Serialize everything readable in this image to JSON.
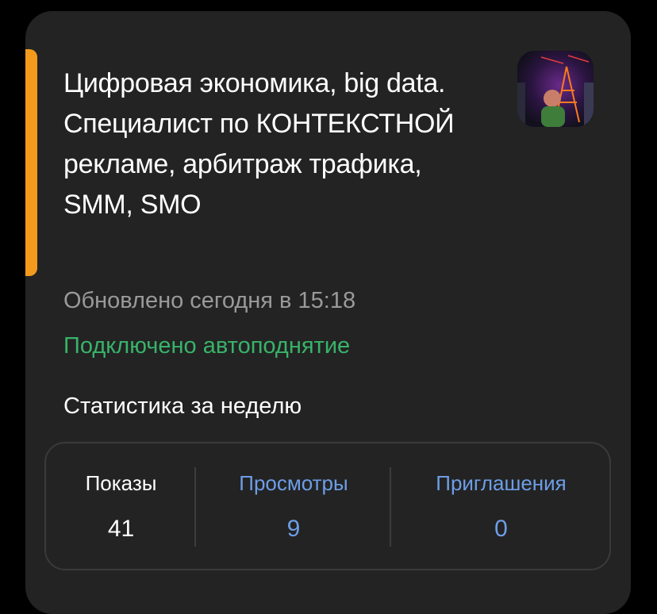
{
  "card": {
    "title": "Цифровая экономика, big data. Специалист по КОНТЕКСТНОЙ рекламе, арбитраж трафика, SMM, SMO",
    "updated": "Обновлено сегодня в 15:18",
    "autoraise": "Подключено автоподнятие",
    "stats_heading": "Статистика за неделю",
    "accent_color": "#f39a1d",
    "status_color": "#38b36a",
    "link_color": "#6d9ee6"
  },
  "stats": {
    "shows": {
      "label": "Показы",
      "value": "41"
    },
    "views": {
      "label": "Просмотры",
      "value": "9"
    },
    "invites": {
      "label": "Приглашения",
      "value": "0"
    }
  }
}
